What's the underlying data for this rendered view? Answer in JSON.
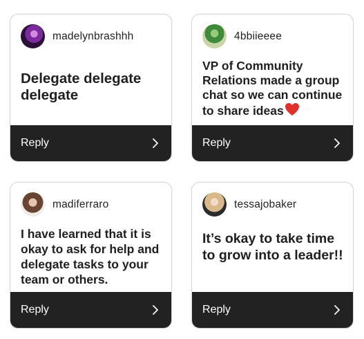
{
  "cards": [
    {
      "username": "madelynbrashhh",
      "message": "Delegate delegate delegate",
      "reply_label": "Reply"
    },
    {
      "username": "4bbiieeee",
      "message": "VP of Community Relations made a group chat so we can continue to share ideas",
      "reply_label": "Reply",
      "emoji": "red-heart-icon"
    },
    {
      "username": "madiferraro",
      "message": "I have learned that it is okay to ask for help and delegate tasks to your team or others.",
      "reply_label": "Reply"
    },
    {
      "username": "tessajobaker",
      "message": "It’s okay to take time to grow into a leader!!",
      "reply_label": "Reply"
    }
  ],
  "colors": {
    "reply_bar": "#222222",
    "card_border": "#d7d7d7",
    "heart": "#e0302c"
  }
}
